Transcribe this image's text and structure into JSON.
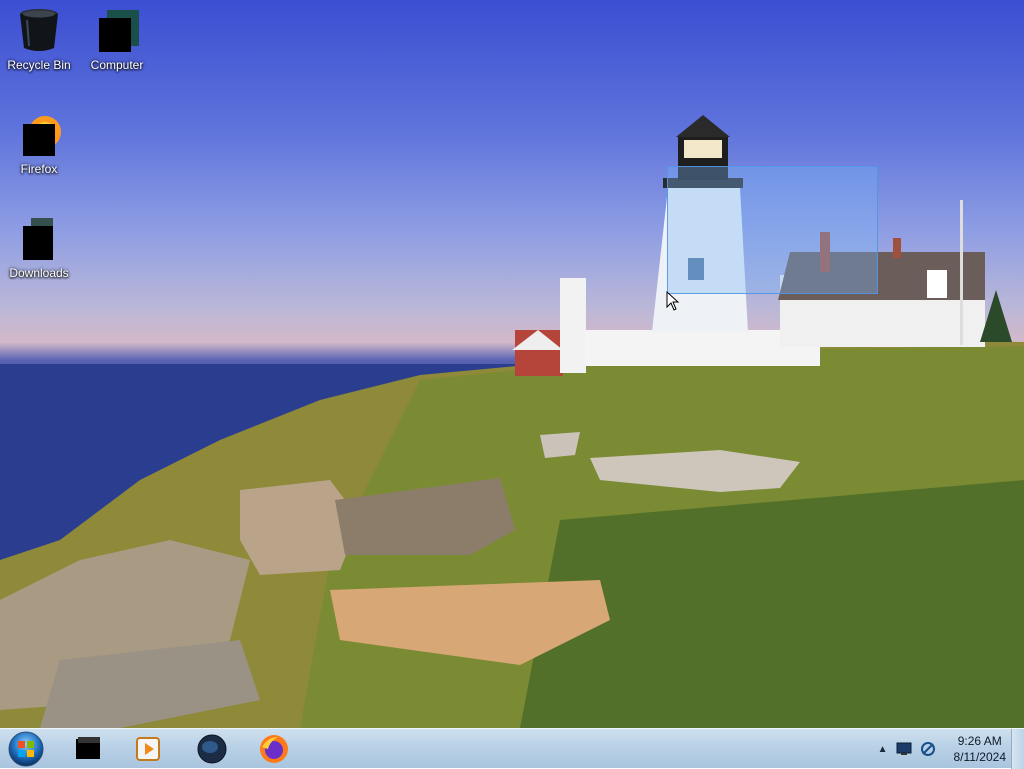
{
  "desktop": {
    "icons": [
      {
        "label": "Recycle Bin",
        "icon": "recycle-bin-icon"
      },
      {
        "label": "Computer",
        "icon": "computer-icon"
      },
      {
        "label": "Firefox",
        "icon": "firefox-icon"
      },
      {
        "label": "Downloads",
        "icon": "downloads-folder-icon"
      }
    ]
  },
  "taskbar": {
    "start": {
      "icon": "windows-start-orb-icon"
    },
    "pinned": [
      {
        "name": "explorer",
        "icon": "folder-icon"
      },
      {
        "name": "media-player",
        "icon": "media-player-icon"
      },
      {
        "name": "network",
        "icon": "globe-icon"
      },
      {
        "name": "firefox",
        "icon": "firefox-icon"
      }
    ],
    "tray": {
      "time": "9:26 AM",
      "date": "8/11/2024",
      "icons": [
        "show-hidden-icons-arrow",
        "display-icon",
        "network-icon"
      ]
    }
  },
  "colors": {
    "taskbar": "#b9d1e6",
    "selection": "#78b4f5",
    "sky_top": "#3b4ed2"
  }
}
